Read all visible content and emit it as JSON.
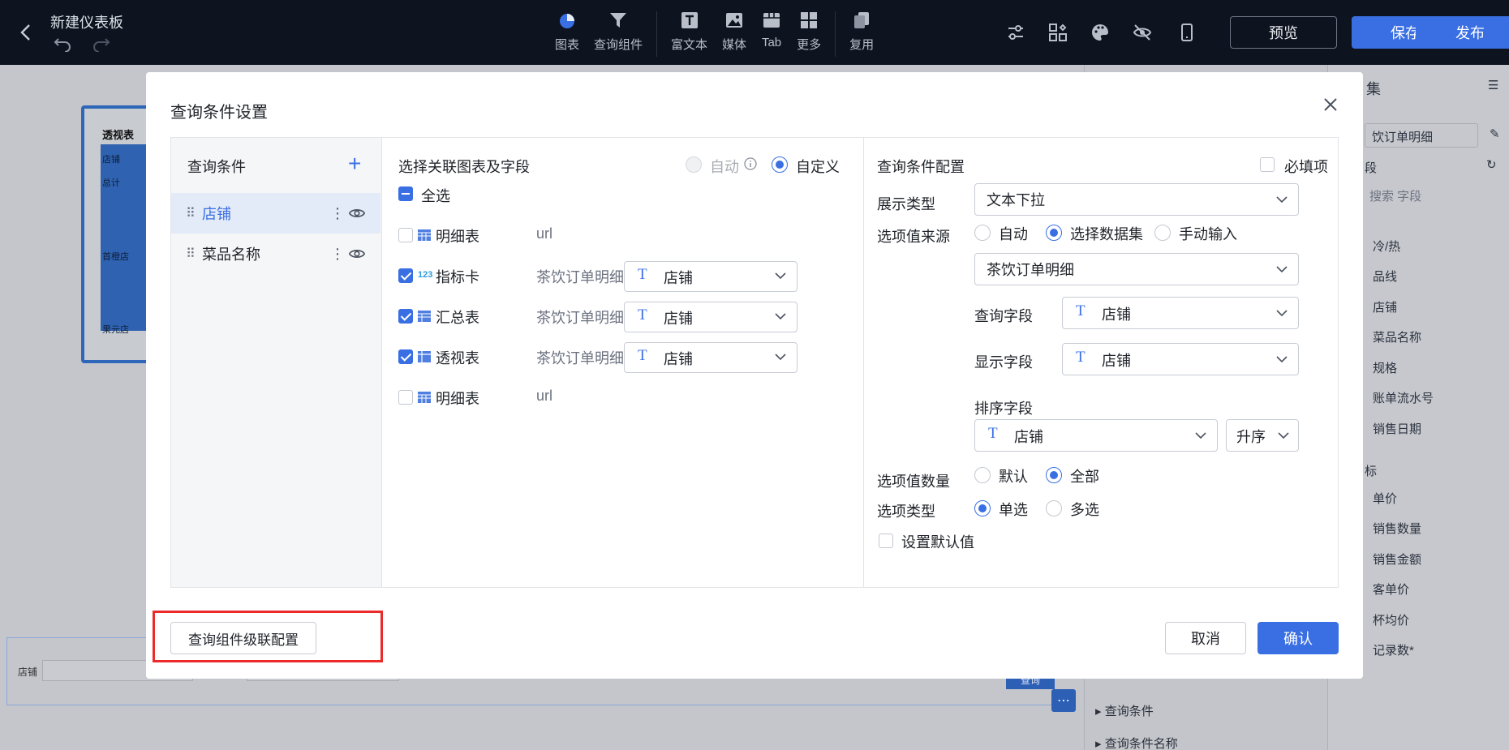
{
  "topbar": {
    "title": "新建仪表板",
    "tools": [
      {
        "label": "图表",
        "icon": "pie-chart-icon"
      },
      {
        "label": "查询组件",
        "icon": "filter-icon"
      },
      {
        "label": "富文本",
        "icon": "text-box-icon"
      },
      {
        "label": "媒体",
        "icon": "image-icon"
      },
      {
        "label": "Tab",
        "icon": "tab-icon"
      },
      {
        "label": "更多",
        "icon": "grid-icon"
      },
      {
        "label": "复用",
        "icon": "copy-icon"
      }
    ],
    "preview_label": "预览",
    "save_label": "保存",
    "publish_label": "发布",
    "accent": "#3a6fe3",
    "bar_color": "#0d1420"
  },
  "background": {
    "pivot_title": "透视表",
    "pivot_rows": [
      "店铺",
      "总计",
      "首橙店",
      "果元店"
    ],
    "query_label": "店铺",
    "query_button": "查询",
    "right_panel_title": "集",
    "right_panel_dataset": "饮订单明细",
    "right_panel_search": "搜索 字段",
    "right_panel_dims_header": "段",
    "right_panel_fields": [
      "冷/热",
      "品线",
      "店铺",
      "菜品名称",
      "规格",
      "账单流水号",
      "销售日期"
    ],
    "right_panel_measures_header": "标",
    "right_panel_measures": [
      "单价",
      "销售数量",
      "销售金额",
      "客单价",
      "杯均价",
      "记录数*"
    ],
    "side_panel_items": [
      "查询条件",
      "查询条件名称"
    ]
  },
  "modal": {
    "title": "查询条件设置",
    "col1": {
      "header": "查询条件",
      "items": [
        {
          "label": "店铺",
          "active": true
        },
        {
          "label": "菜品名称",
          "active": false
        }
      ]
    },
    "col2": {
      "header": "选择关联图表及字段",
      "mode_auto": "自动",
      "mode_custom": "自定义",
      "select_all": "全选",
      "rows": [
        {
          "type_icon": "table-icon",
          "name": "明细表",
          "dataset": "url",
          "checked": false,
          "field": ""
        },
        {
          "type_icon": "number-card-icon",
          "name": "指标卡",
          "dataset": "茶饮订单明细",
          "checked": true,
          "field": "店铺"
        },
        {
          "type_icon": "summary-table-icon",
          "name": "汇总表",
          "dataset": "茶饮订单明细",
          "checked": true,
          "field": "店铺"
        },
        {
          "type_icon": "pivot-table-icon",
          "name": "透视表",
          "dataset": "茶饮订单明细",
          "checked": true,
          "field": "店铺"
        },
        {
          "type_icon": "table-icon",
          "name": "明细表",
          "dataset": "url",
          "checked": false,
          "field": ""
        }
      ],
      "number_icon_text": "123",
      "field_type_glyph": "T"
    },
    "col3": {
      "header": "查询条件配置",
      "required_label": "必填项",
      "display_type_label": "展示类型",
      "display_type_value": "文本下拉",
      "source_label": "选项值来源",
      "source_options": [
        "自动",
        "选择数据集",
        "手动输入"
      ],
      "source_selected": "选择数据集",
      "dataset_value": "茶饮订单明细",
      "query_field_label": "查询字段",
      "query_field_value": "店铺",
      "display_field_label": "显示字段",
      "display_field_value": "店铺",
      "sort_field_label": "排序字段",
      "sort_field_value": "店铺",
      "sort_order": "升序",
      "count_label": "选项值数量",
      "count_options": [
        "默认",
        "全部"
      ],
      "count_selected": "全部",
      "option_type_label": "选项类型",
      "option_type_options": [
        "单选",
        "多选"
      ],
      "option_type_selected": "单选",
      "default_value_label": "设置默认值"
    },
    "footer": {
      "cascade_label": "查询组件级联配置",
      "cancel_label": "取消",
      "ok_label": "确认",
      "highlight_color": "#ec2a2a"
    }
  }
}
